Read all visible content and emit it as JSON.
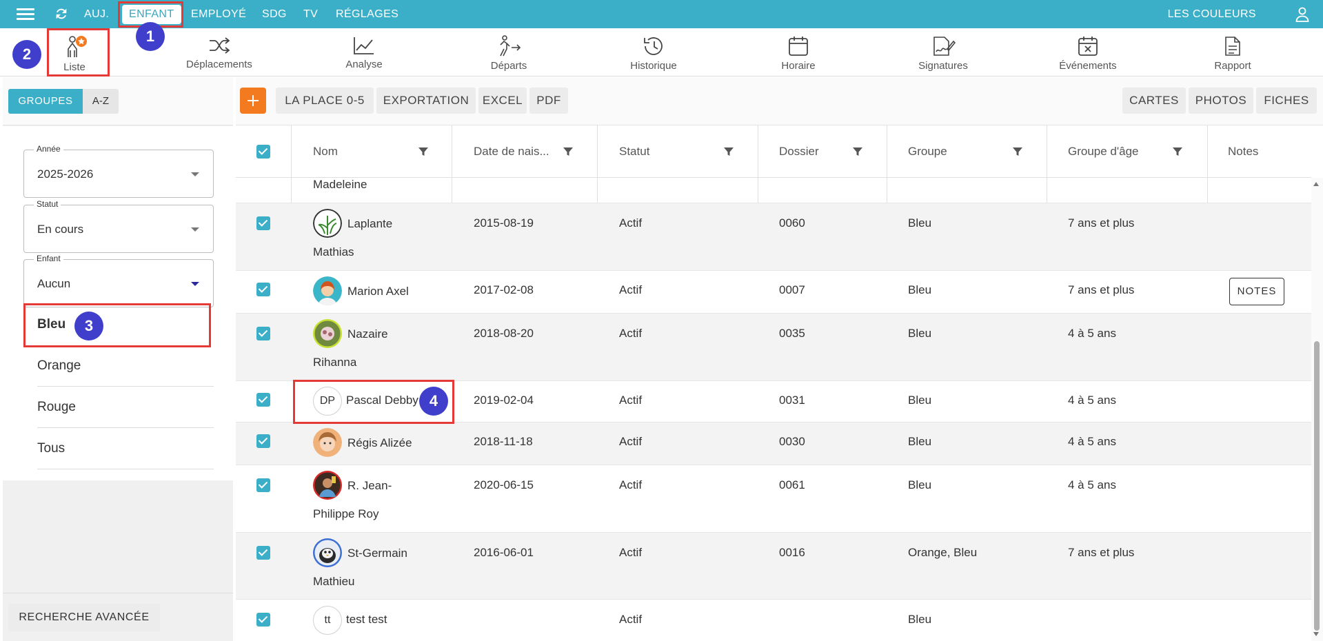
{
  "nav": {
    "items": [
      "AUJ.",
      "ENFANT",
      "EMPLOYÉ",
      "SDG",
      "TV",
      "RÉGLAGES"
    ],
    "right_label": "LES COULEURS"
  },
  "toolbar": {
    "tools": [
      "Liste",
      "Déplacements",
      "Analyse",
      "Départs",
      "Historique",
      "Horaire",
      "Signatures",
      "Événements",
      "Rapport"
    ]
  },
  "left": {
    "tab_groupes": "GROUPES",
    "tab_az": "A-Z",
    "filters": [
      {
        "caption": "Année",
        "value": "2025-2026"
      },
      {
        "caption": "Statut",
        "value": "En cours"
      },
      {
        "caption": "Enfant",
        "value": "Aucun"
      }
    ],
    "groups": [
      "Bleu",
      "Orange",
      "Rouge",
      "Tous"
    ],
    "advanced_search": "RECHERCHE AVANCÉE"
  },
  "actions": {
    "plus": "+",
    "buttons": [
      "LA PLACE 0-5",
      "EXPORTATION",
      "EXCEL",
      "PDF"
    ],
    "right_buttons": [
      "CARTES",
      "PHOTOS",
      "FICHES"
    ]
  },
  "table": {
    "headers": [
      "Nom",
      "Date de nais...",
      "Statut",
      "Dossier",
      "Groupe",
      "Groupe d'âge",
      "Notes"
    ],
    "partial_row_name": "Madeleine",
    "rows": [
      {
        "name1": "Laplante",
        "name2": "Mathias",
        "date": "2015-08-19",
        "statut": "Actif",
        "dossier": "0060",
        "groupe": "Bleu",
        "age": "7 ans et plus",
        "notes": ""
      },
      {
        "name1": "Marion Axel",
        "name2": "",
        "date": "2017-02-08",
        "statut": "Actif",
        "dossier": "0007",
        "groupe": "Bleu",
        "age": "7 ans et plus",
        "notes": "NOTES"
      },
      {
        "name1": "Nazaire",
        "name2": "Rihanna",
        "date": "2018-08-20",
        "statut": "Actif",
        "dossier": "0035",
        "groupe": "Bleu",
        "age": "4 à 5 ans",
        "notes": ""
      },
      {
        "name1": "Pascal Debby",
        "name2": "",
        "initials": "DP",
        "date": "2019-02-04",
        "statut": "Actif",
        "dossier": "0031",
        "groupe": "Bleu",
        "age": "4 à 5 ans",
        "notes": ""
      },
      {
        "name1": "Régis Alizée",
        "name2": "",
        "date": "2018-11-18",
        "statut": "Actif",
        "dossier": "0030",
        "groupe": "Bleu",
        "age": "4 à 5 ans",
        "notes": ""
      },
      {
        "name1": "R. Jean-",
        "name2": "Philippe Roy",
        "date": "2020-06-15",
        "statut": "Actif",
        "dossier": "0061",
        "groupe": "Bleu",
        "age": "4 à 5 ans",
        "notes": ""
      },
      {
        "name1": "St-Germain",
        "name2": "Mathieu",
        "date": "2016-06-01",
        "statut": "Actif",
        "dossier": "0016",
        "groupe": "Orange, Bleu",
        "age": "7 ans et plus",
        "notes": ""
      },
      {
        "name1": "test test",
        "name2": "",
        "initials": "tt",
        "date": "",
        "statut": "Actif",
        "dossier": "",
        "groupe": "Bleu",
        "age": "",
        "notes": ""
      }
    ]
  },
  "annotations": [
    "1",
    "2",
    "3",
    "4"
  ],
  "colors": {
    "primary": "#3bafc8",
    "accent_orange": "#f47a1f",
    "highlight_red": "#e53935",
    "badge_blue": "#3f3fcc"
  }
}
